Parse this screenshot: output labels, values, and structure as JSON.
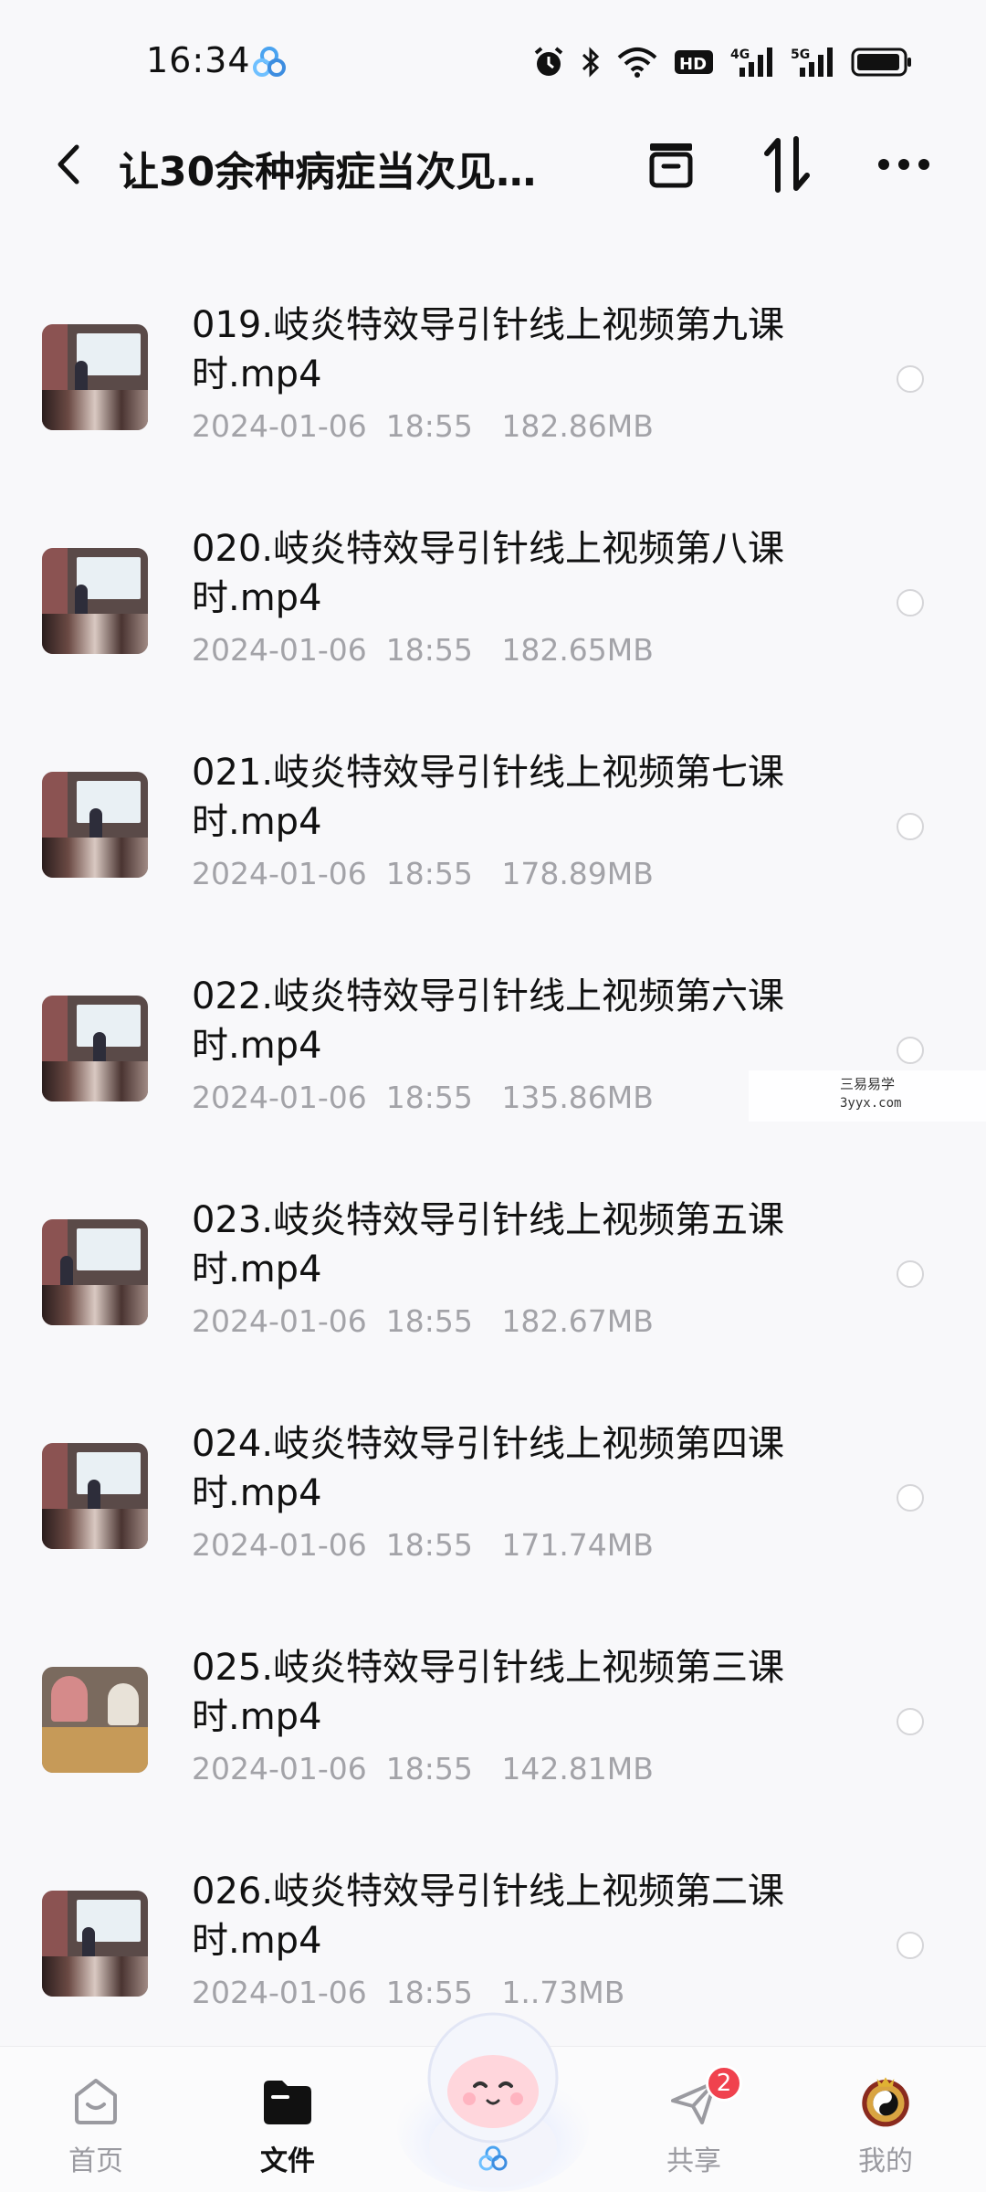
{
  "status_bar": {
    "time": "16:34",
    "icons": [
      "app-icon",
      "alarm-icon",
      "bluetooth-icon",
      "wifi-icon",
      "hd-icon",
      "signal-4g-icon",
      "signal-5g-icon",
      "battery-icon"
    ],
    "hd_label": "HD",
    "net1": "4G",
    "net2": "5G"
  },
  "header": {
    "title": "让30余种病症当次见…",
    "icons": [
      "back-icon",
      "archive-icon",
      "sort-icon",
      "more-icon"
    ]
  },
  "files": [
    {
      "name": "019.岐炎特效导引针线上视频第九课时.mp4",
      "meta": "2024-01-06  18:55   182.86MB"
    },
    {
      "name": "020.岐炎特效导引针线上视频第八课时.mp4",
      "meta": "2024-01-06  18:55   182.65MB"
    },
    {
      "name": "021.岐炎特效导引针线上视频第七课时.mp4",
      "meta": "2024-01-06  18:55   178.89MB"
    },
    {
      "name": "022.岐炎特效导引针线上视频第六课时.mp4",
      "meta": "2024-01-06  18:55   135.86MB"
    },
    {
      "name": "023.岐炎特效导引针线上视频第五课时.mp4",
      "meta": "2024-01-06  18:55   182.67MB"
    },
    {
      "name": "024.岐炎特效导引针线上视频第四课时.mp4",
      "meta": "2024-01-06  18:55   171.74MB"
    },
    {
      "name": "025.岐炎特效导引针线上视频第三课时.mp4",
      "meta": "2024-01-06  18:55   142.81MB"
    },
    {
      "name": "026.岐炎特效导引针线上视频第二课时.mp4",
      "meta": "2024-01-06  18:55   1..73MB"
    }
  ],
  "watermark": {
    "line1": "三易易学",
    "line2": "3yyx.com"
  },
  "nav": {
    "home": "首页",
    "files": "文件",
    "share": "共享",
    "mine": "我的",
    "share_badge": "2"
  },
  "colors": {
    "accent": "#111111",
    "meta_gray": "#a3a3a8",
    "badge_red": "#f0424e"
  }
}
